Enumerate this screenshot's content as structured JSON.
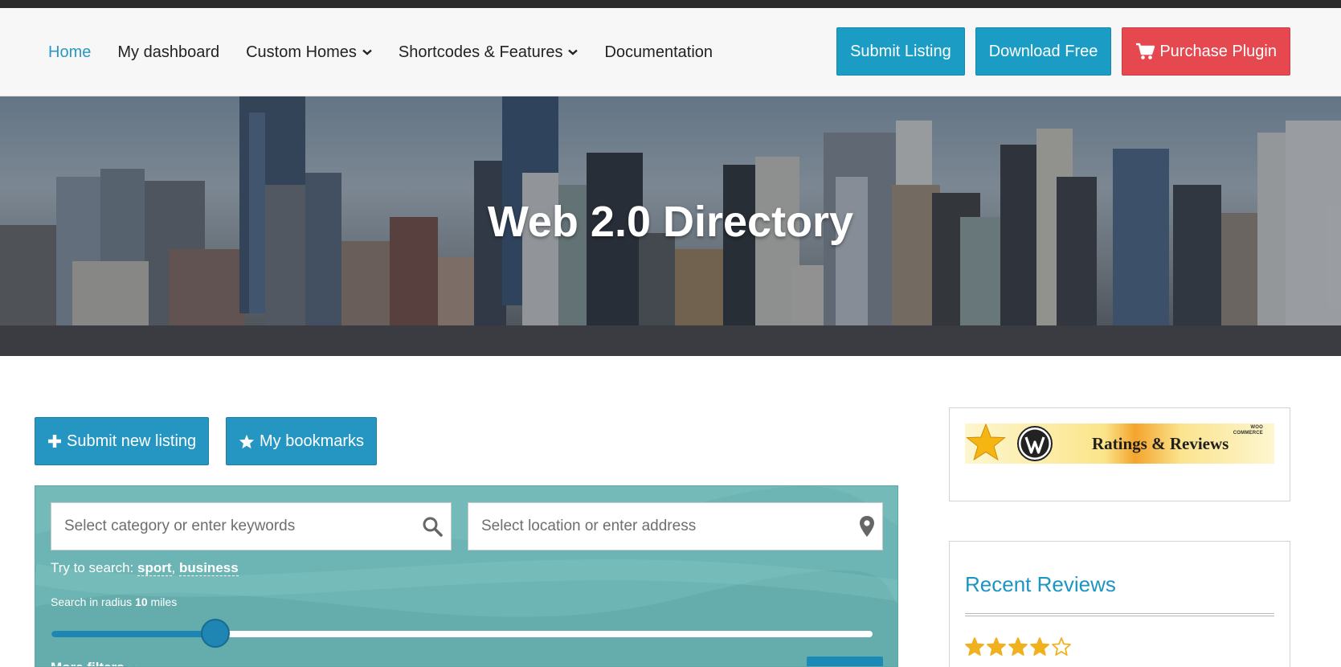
{
  "nav": {
    "links": [
      {
        "label": "Home",
        "active": true,
        "dropdown": false
      },
      {
        "label": "My dashboard",
        "active": false,
        "dropdown": false
      },
      {
        "label": "Custom Homes",
        "active": false,
        "dropdown": true
      },
      {
        "label": "Shortcodes & Features",
        "active": false,
        "dropdown": true
      },
      {
        "label": "Documentation",
        "active": false,
        "dropdown": false
      }
    ],
    "buttons": {
      "submit_listing": "Submit Listing",
      "download_free": "Download Free",
      "purchase_plugin": "Purchase Plugin"
    }
  },
  "hero": {
    "title": "Web 2.0 Directory"
  },
  "actions": {
    "submit_new_listing": "Submit new listing",
    "my_bookmarks": "My bookmarks"
  },
  "search": {
    "keywords_placeholder": "Select category or enter keywords",
    "location_placeholder": "Select location or enter address",
    "try_prefix": "Try to search:",
    "suggestions": [
      "sport",
      "business"
    ],
    "radius_prefix": "Search in radius",
    "radius_value": "10",
    "radius_unit": "miles",
    "radius_slider_fraction": 0.2,
    "more_filters": "More filters"
  },
  "sidebar": {
    "banner": {
      "text": "Ratings & Reviews",
      "badge_top": "WOO",
      "badge_bottom": "COMMERCE"
    },
    "recent_reviews": {
      "title": "Recent Reviews",
      "rating": 4,
      "max_rating": 5
    }
  },
  "colors": {
    "accent": "#1b9cc5",
    "purchase": "#e5484e",
    "active_link": "#2a97c4",
    "search_panel": "#6db5b4",
    "star": "#f0b11f"
  },
  "icons": {
    "chevron": "chevron-down-icon",
    "cart": "cart-icon",
    "plus": "plus-icon",
    "star": "star-icon",
    "search": "search-icon",
    "location": "map-marker-icon"
  }
}
